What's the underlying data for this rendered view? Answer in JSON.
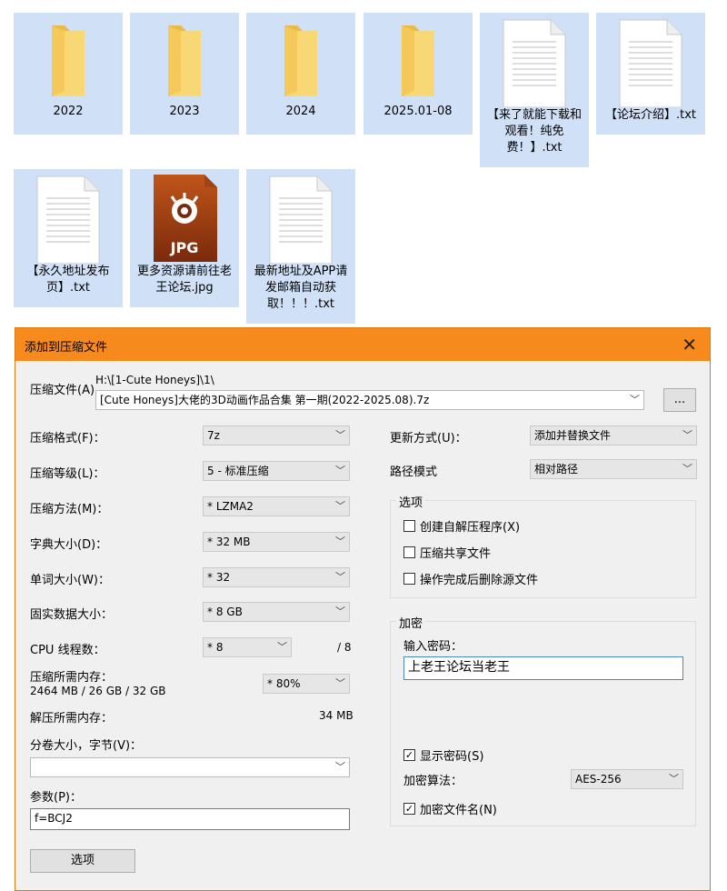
{
  "explorer": {
    "items": [
      {
        "label": "2022",
        "type": "folder"
      },
      {
        "label": "2023",
        "type": "folder"
      },
      {
        "label": "2024",
        "type": "folder"
      },
      {
        "label": "2025.01-08",
        "type": "folder"
      },
      {
        "label": "【来了就能下载和观看！纯免费！】.txt",
        "type": "text-file"
      },
      {
        "label": "【论坛介绍】.txt",
        "type": "text-file"
      },
      {
        "label": "【永久地址发布页】.txt",
        "type": "text-file"
      },
      {
        "label": "更多资源请前往老王论坛.jpg",
        "type": "jpg-file",
        "badge": "JPG"
      },
      {
        "label": "最新地址及APP请发邮箱自动获取！！！.txt",
        "type": "text-file"
      }
    ]
  },
  "dialog": {
    "title": "添加到压缩文件",
    "close_icon": "close-icon",
    "archive": {
      "label": "压缩文件(A)",
      "path": "H:\\[1-Cute Honeys]\\1\\",
      "value": "[Cute Honeys]大佬的3D动画作品合集 第一期(2022-2025.08).7z",
      "browse_label": "..."
    },
    "left": {
      "format": {
        "label": "压缩格式(F)：",
        "value": "7z"
      },
      "level": {
        "label": "压缩等级(L)：",
        "value": "5 - 标准压缩"
      },
      "method": {
        "label": "压缩方法(M)：",
        "value": "* LZMA2"
      },
      "dict": {
        "label": "字典大小(D)：",
        "value": "* 32 MB"
      },
      "word": {
        "label": "单词大小(W)：",
        "value": "* 32"
      },
      "solid": {
        "label": "固实数据大小：",
        "value": "* 8 GB"
      },
      "threads": {
        "label": "CPU 线程数：",
        "value": "* 8",
        "max": "/ 8"
      },
      "mem": {
        "label": "压缩所需内存：",
        "detail": "2464 MB / 26 GB / 32 GB",
        "value": "* 80%"
      },
      "decomp": {
        "label": "解压所需内存：",
        "value": "34 MB"
      },
      "volume": {
        "label": "分卷大小，字节(V)：",
        "value": ""
      },
      "params": {
        "label": "参数(P)：",
        "value": "f=BCJ2"
      },
      "options_button": "选项"
    },
    "right": {
      "update": {
        "label": "更新方式(U)：",
        "value": "添加并替换文件"
      },
      "pathmode": {
        "label": "路径模式",
        "value": "相对路径"
      },
      "options_group": {
        "title": "选项",
        "items": [
          {
            "label": "创建自解压程序(X)",
            "checked": false
          },
          {
            "label": "压缩共享文件",
            "checked": false
          },
          {
            "label": "操作完成后删除源文件",
            "checked": false
          }
        ]
      },
      "encrypt_group": {
        "title": "加密",
        "password_label": "输入密码：",
        "password_value": "上老王论坛当老王",
        "show_password": {
          "label": "显示密码(S)",
          "checked": true
        },
        "method_label": "加密算法：",
        "method_value": "AES-256",
        "encrypt_names": {
          "label": "加密文件名(N)",
          "checked": true
        }
      }
    }
  },
  "colors": {
    "titlebar": "#f78a1d",
    "selection": "#cfe0f7",
    "folder": "#f8d775"
  }
}
